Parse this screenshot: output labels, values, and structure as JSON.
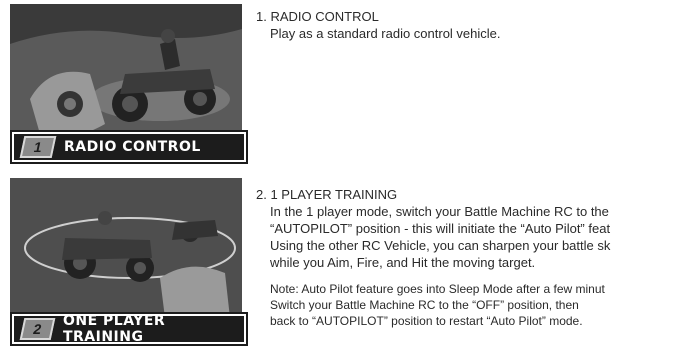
{
  "sections": [
    {
      "badge": "1",
      "banner": "RADIO CONTROL",
      "heading": "1. RADIO CONTROL",
      "lines": [
        "Play as a standard radio control vehicle."
      ]
    },
    {
      "badge": "2",
      "banner": "ONE PLAYER TRAINING",
      "heading": "2. 1 PLAYER TRAINING",
      "lines": [
        "In the 1 player mode, switch your Battle Machine RC to the",
        "“AUTOPILOT” position - this will initiate the “Auto Pilot” feat",
        "Using the other RC Vehicle, you can sharpen your battle sk",
        "while you Aim, Fire, and Hit the moving target."
      ],
      "note": [
        "Note: Auto Pilot feature goes into Sleep Mode after a few minut",
        "Switch your Battle Machine RC to the “OFF” position, then",
        "back to “AUTOPILOT” position to restart “Auto Pilot” mode."
      ]
    }
  ]
}
